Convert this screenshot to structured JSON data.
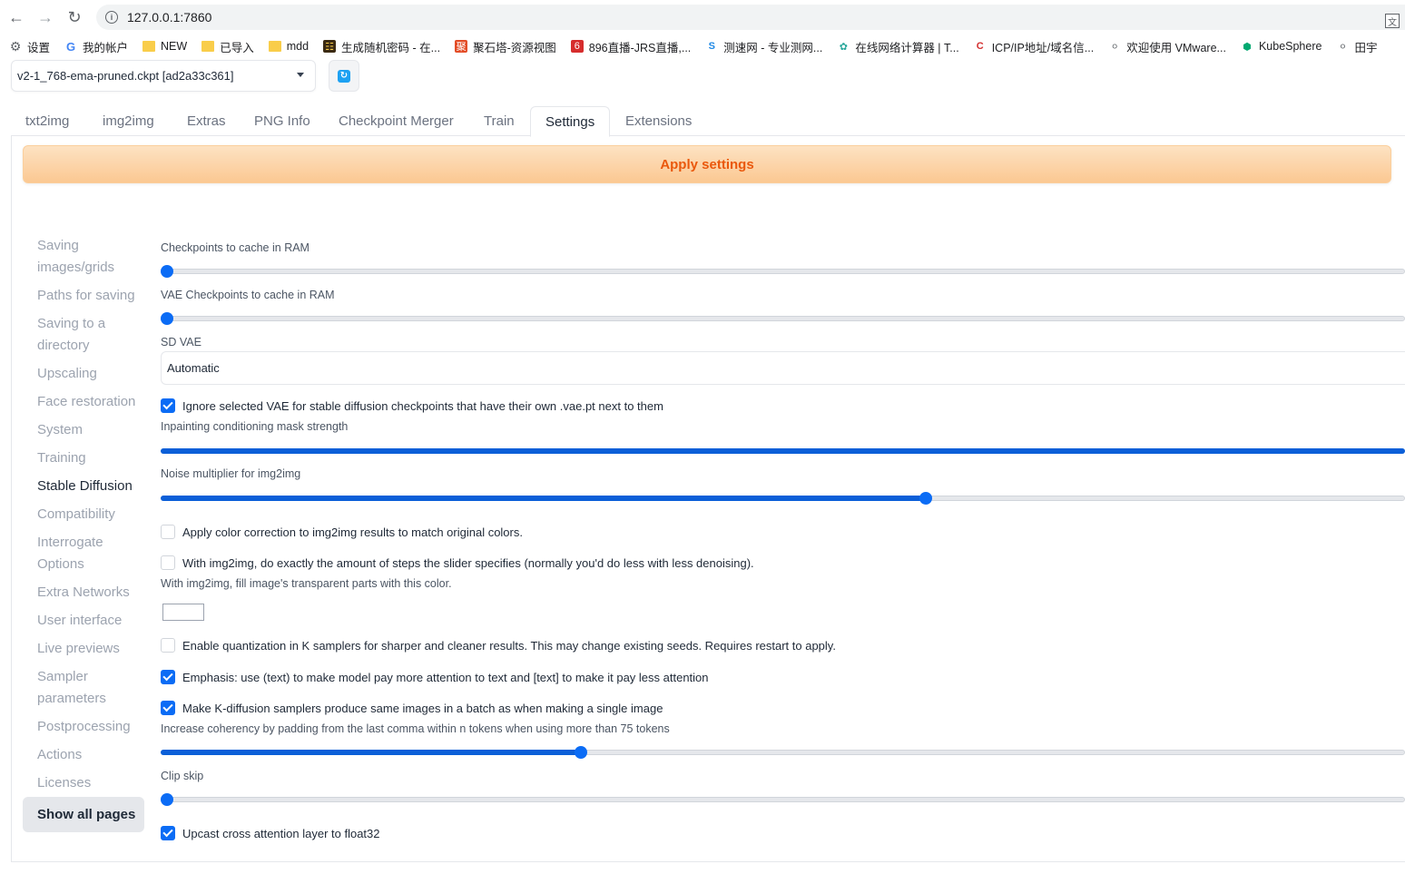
{
  "browser": {
    "url": "127.0.0.1:7860",
    "bookmarks": [
      {
        "label": "设置",
        "icon": "gear-icon"
      },
      {
        "label": "我的帐户",
        "icon": "google-icon"
      },
      {
        "label": "NEW",
        "icon": "folder-icon"
      },
      {
        "label": "已导入",
        "icon": "folder-icon"
      },
      {
        "label": "mdd",
        "icon": "folder-icon"
      },
      {
        "label": "生成随机密码 - 在...",
        "icon": "site-icon"
      },
      {
        "label": "聚石塔-资源视图",
        "icon": "site-icon"
      },
      {
        "label": "896直播-JRS直播,...",
        "icon": "site-icon"
      },
      {
        "label": "测速网 - 专业测网...",
        "icon": "site-icon"
      },
      {
        "label": "在线网络计算器 | T...",
        "icon": "site-icon"
      },
      {
        "label": "ICP/IP地址/域名信...",
        "icon": "site-icon"
      },
      {
        "label": "欢迎使用 VMware...",
        "icon": "globe-icon"
      },
      {
        "label": "KubeSphere",
        "icon": "site-icon"
      },
      {
        "label": "田宇",
        "icon": "globe-icon"
      }
    ]
  },
  "model": {
    "selected": "v2-1_768-ema-pruned.ckpt [ad2a33c361]"
  },
  "tabs": [
    {
      "label": "txt2img"
    },
    {
      "label": "img2img"
    },
    {
      "label": "Extras"
    },
    {
      "label": "PNG Info"
    },
    {
      "label": "Checkpoint Merger"
    },
    {
      "label": "Train"
    },
    {
      "label": "Settings"
    },
    {
      "label": "Extensions"
    }
  ],
  "apply_label": "Apply settings",
  "sidebar": {
    "items": [
      {
        "label": "Saving images/grids"
      },
      {
        "label": "Paths for saving"
      },
      {
        "label": "Saving to a directory"
      },
      {
        "label": "Upscaling"
      },
      {
        "label": "Face restoration"
      },
      {
        "label": "System"
      },
      {
        "label": "Training"
      },
      {
        "label": "Stable Diffusion"
      },
      {
        "label": "Compatibility"
      },
      {
        "label": "Interrogate Options"
      },
      {
        "label": "Extra Networks"
      },
      {
        "label": "User interface"
      },
      {
        "label": "Live previews"
      },
      {
        "label": "Sampler parameters"
      },
      {
        "label": "Postprocessing"
      },
      {
        "label": "Actions"
      },
      {
        "label": "Licenses"
      }
    ],
    "active": "Stable Diffusion",
    "show_all": "Show all pages"
  },
  "settings": {
    "checkpoints_cache": {
      "label": "Checkpoints to cache in RAM",
      "fraction": 0.0
    },
    "vae_cache": {
      "label": "VAE Checkpoints to cache in RAM",
      "fraction": 0.0
    },
    "sd_vae": {
      "label": "SD VAE",
      "value": "Automatic"
    },
    "ignore_vae": {
      "label": "Ignore selected VAE for stable diffusion checkpoints that have their own .vae.pt next to them",
      "checked": true
    },
    "inpaint_mask": {
      "label": "Inpainting conditioning mask strength",
      "fraction": 1.0
    },
    "noise_mult": {
      "label": "Noise multiplier for img2img",
      "fraction": 0.613
    },
    "color_correction": {
      "label": "Apply color correction to img2img results to match original colors.",
      "checked": false
    },
    "exact_steps": {
      "label": "With img2img, do exactly the amount of steps the slider specifies (normally you'd do less with less denoising).",
      "checked": false
    },
    "fill_color": {
      "label": "With img2img, fill image's transparent parts with this color.",
      "color": "#ffffff"
    },
    "quantization": {
      "label": "Enable quantization in K samplers for sharper and cleaner results. This may change existing seeds. Requires restart to apply.",
      "checked": false
    },
    "emphasis": {
      "label": "Emphasis: use (text) to make model pay more attention to text and [text] to make it pay less attention",
      "checked": true
    },
    "batch_same": {
      "label": "Make K-diffusion samplers produce same images in a batch as when making a single image",
      "checked": true
    },
    "comma_padding": {
      "label": "Increase coherency by padding from the last comma within n tokens when using more than 75 tokens",
      "fraction": 0.334
    },
    "clip_skip": {
      "label": "Clip skip",
      "fraction": 0.0
    },
    "upcast": {
      "label": "Upcast cross attention layer to float32",
      "checked": true
    }
  },
  "colors": {
    "accent": "#0b6cf5",
    "apply_text": "#ea580c"
  }
}
